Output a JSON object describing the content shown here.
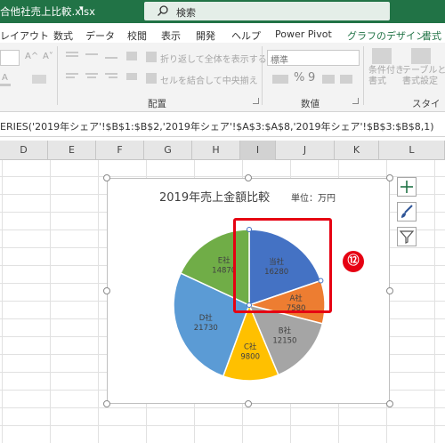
{
  "titlebar": {
    "filename": "合他社売上比較.xlsx",
    "caret": "▾",
    "search_label": "検索"
  },
  "tabs": [
    {
      "label": "レイアウト"
    },
    {
      "label": "数式"
    },
    {
      "label": "データ"
    },
    {
      "label": "校閲"
    },
    {
      "label": "表示"
    },
    {
      "label": "開発"
    },
    {
      "label": "ヘルプ"
    },
    {
      "label": "Power Pivot"
    },
    {
      "label": "グラフのデザイン"
    },
    {
      "label": "書式"
    }
  ],
  "ribbon": {
    "font_grow": "A^",
    "font_shrink": "A˅",
    "font_color": "A",
    "wrap_text": "折り返して全体を表示する",
    "merge_center": "セルを結合して中央揃え",
    "number_format": "標準",
    "percent": "%",
    "comma": "9",
    "conditional_format": "条件付き\n書式",
    "table_format": "テーブルとして\n書式設定",
    "groups": {
      "alignment": "配置",
      "number": "数値",
      "styles": "スタイル"
    }
  },
  "formula_bar": {
    "text": "ERIES('2019年シェア'!$B$1:$B$2,'2019年シェア'!$A$3:$A$8,'2019年シェア'!$B$3:$B$8,1)"
  },
  "columns": [
    "D",
    "E",
    "F",
    "G",
    "H",
    "I",
    "J",
    "K",
    "L"
  ],
  "chart": {
    "title": "2019年売上金額比較",
    "unit_label": "単位：万円",
    "annotation_badge": "⑫",
    "side_buttons": [
      "plus-icon",
      "brush-icon",
      "filter-icon"
    ]
  },
  "chart_data": {
    "type": "pie",
    "title": "2019年売上金額比較",
    "subtitle": "単位：万円",
    "categories": [
      "当社",
      "A社",
      "B社",
      "C社",
      "D社",
      "E社"
    ],
    "values": [
      16280,
      7580,
      12150,
      9800,
      21730,
      14870
    ],
    "colors": [
      "#4472c4",
      "#ed7d31",
      "#a5a5a5",
      "#ffc000",
      "#5b9bd5",
      "#70ad47"
    ],
    "data_labels": [
      "当社\n16280",
      "A社\n7580",
      "B社\n12150",
      "C社\n9800",
      "D社\n21730",
      "E社\n14870"
    ]
  }
}
